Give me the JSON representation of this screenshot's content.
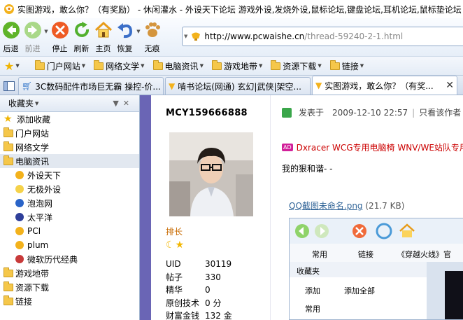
{
  "window": {
    "title": "实图游戏，敢么你？（有奖励） - 休闲灌水 - 外设天下论坛 游戏外设,发烧外设,鼠标论坛,键盘论坛,耳机论坛,鼠标垫论坛"
  },
  "toolbar": {
    "back": "后退",
    "forward": "前进",
    "stop": "停止",
    "refresh": "刷新",
    "home": "主页",
    "restore": "恢复",
    "incognito": "无痕"
  },
  "address": {
    "domain": "http://www.pcwaishe.cn",
    "path": "/thread-59240-2-1.html"
  },
  "favbar": {
    "items": [
      {
        "label": "门户网站"
      },
      {
        "label": "网络文学"
      },
      {
        "label": "电脑资讯"
      },
      {
        "label": "游戏地带"
      },
      {
        "label": "资源下载"
      },
      {
        "label": "链接"
      }
    ]
  },
  "tabs": [
    {
      "label": "3C数码配件市场巨无霸 操控-价..."
    },
    {
      "label": "啃书论坛(网通) 玄幻|武侠|架空..."
    },
    {
      "label": "实图游戏，敢么你？（有奖..."
    }
  ],
  "sidebar": {
    "title": "收藏夹",
    "add": "添加收藏",
    "items": [
      {
        "label": "门户网站",
        "type": "folder"
      },
      {
        "label": "网络文学",
        "type": "folder"
      },
      {
        "label": "电脑资讯",
        "type": "folder-open"
      },
      {
        "label": "外设天下",
        "type": "child"
      },
      {
        "label": "无极外设",
        "type": "child"
      },
      {
        "label": "泡泡网",
        "type": "child"
      },
      {
        "label": "太平洋",
        "type": "child"
      },
      {
        "label": "PCI",
        "type": "child"
      },
      {
        "label": "plum",
        "type": "child"
      },
      {
        "label": "微软历代经典",
        "type": "child"
      },
      {
        "label": "游戏地带",
        "type": "folder"
      },
      {
        "label": "资源下载",
        "type": "folder"
      },
      {
        "label": "链接",
        "type": "folder"
      }
    ]
  },
  "profile": {
    "username": "MCY159666888",
    "rank": "排长",
    "stats": [
      {
        "k": "UID",
        "v": "30119"
      },
      {
        "k": "帖子",
        "v": "330"
      },
      {
        "k": "精华",
        "v": "0"
      },
      {
        "k": "原创技术",
        "v": "0 分"
      },
      {
        "k": "财富金钱",
        "v": "132 金"
      }
    ]
  },
  "post": {
    "posted_label": "发表于",
    "posted_time": "2009-12-10 22:57",
    "only_author": "只看该作者",
    "ad_tag": "AD",
    "ad_text": "Dxracer WCG专用电脑椅 WNV/WE站队专用",
    "text": "我的狠和谐- -",
    "attachment_name": "QQ截图未命名.png",
    "attachment_size": "(21.7 KB)"
  },
  "inner_shot": {
    "fav_items": [
      "常用",
      "链接",
      "《穿越火线》官"
    ],
    "sidebar_title": "收藏夹",
    "add": "添加",
    "add_all": "添加全部",
    "folder": "常用"
  },
  "colors": {
    "stripe": "#6a65b5",
    "rank": "#c86a00",
    "ad": "#cc0000",
    "link": "#336699"
  }
}
